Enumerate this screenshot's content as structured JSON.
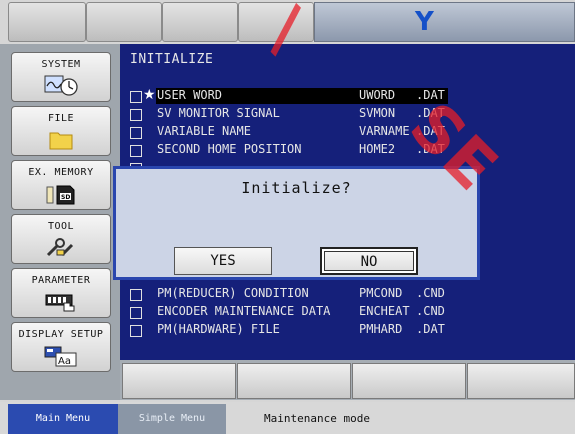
{
  "header": {
    "indicator": "Y"
  },
  "sidebar": {
    "items": [
      {
        "label": "SYSTEM",
        "icon": "chart-gauge-icon"
      },
      {
        "label": "FILE",
        "icon": "folder-icon"
      },
      {
        "label": "EX. MEMORY",
        "icon": "sd-card-icon"
      },
      {
        "label": "TOOL",
        "icon": "tool-icon"
      },
      {
        "label": "PARAMETER",
        "icon": "parameter-hand-icon"
      },
      {
        "label": "DISPLAY SETUP",
        "icon": "display-font-icon"
      }
    ]
  },
  "main": {
    "title": "INITIALIZE",
    "rows": [
      {
        "name": "USER WORD",
        "file": "UWORD",
        "ext": ".DAT",
        "starred": true
      },
      {
        "name": "SV MONITOR SIGNAL",
        "file": "SVMON",
        "ext": ".DAT"
      },
      {
        "name": "VARIABLE NAME",
        "file": "VARNAME",
        "ext": ".DAT"
      },
      {
        "name": "SECOND HOME POSITION",
        "file": "HOME2",
        "ext": ".DAT"
      },
      {
        "name": "PM(REDUCER) CONDITION",
        "file": "PMCOND",
        "ext": ".CND"
      },
      {
        "name": "ENCODER MAINTENANCE DATA",
        "file": "ENCHEAT",
        "ext": ".CND"
      },
      {
        "name": "PM(HARDWARE) FILE",
        "file": "PMHARD",
        "ext": ".DAT"
      }
    ]
  },
  "dialog": {
    "title": "Initialize?",
    "yes": "YES",
    "no": "NO"
  },
  "status": {
    "main_menu": "Main Menu",
    "simple_menu": "Simple Menu",
    "mode": "Maintenance mode"
  },
  "watermark": "SE",
  "colors": {
    "screen_bg": "#15207a",
    "dialog_border": "#2a46ae",
    "main_menu_bg": "#2b4bb0",
    "watermark": "#e61e28"
  }
}
